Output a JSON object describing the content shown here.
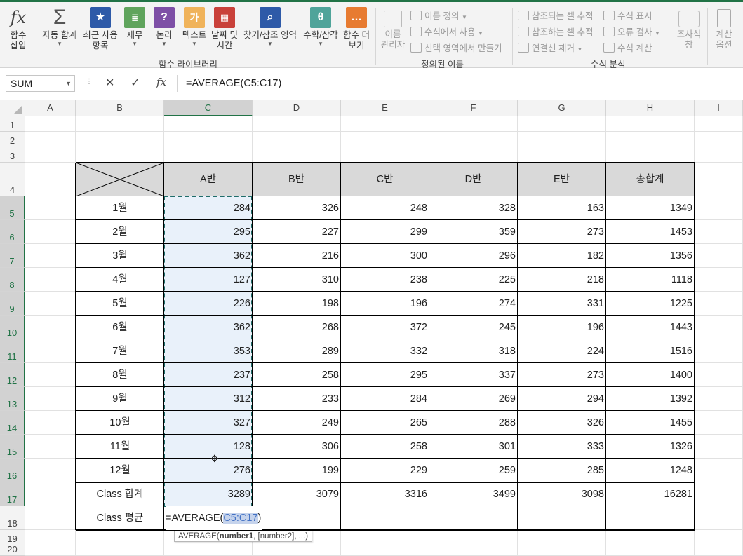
{
  "ribbon": {
    "insert_function": [
      "함수",
      "삽입"
    ],
    "autosum": "자동 합계",
    "recent": [
      "최근 사용",
      "항목"
    ],
    "financial": "재무",
    "logical": "논리",
    "text": "텍스트",
    "datetime": [
      "날짜 및",
      "시간"
    ],
    "lookup": "찾기/참조 영역",
    "math": "수학/삼각",
    "more": [
      "함수 더",
      "보기"
    ],
    "group_library": "함수 라이브러리",
    "name_manager": [
      "이름",
      "관리자"
    ],
    "define_name": "이름 정의",
    "use_in_formula": "수식에서 사용",
    "create_from_selection": "선택 영역에서 만들기",
    "group_defined_names": "정의된 이름",
    "trace_precedents": "참조되는 셀 추적",
    "trace_dependents": "참조하는 셀 추적",
    "remove_arrows": "연결선 제거",
    "show_formulas": "수식 표시",
    "error_checking": "오류 검사",
    "evaluate_formula": "수식 계산",
    "group_formula_auditing": "수식 분석",
    "watch_window": [
      "조사식",
      "창"
    ],
    "calc_options": [
      "계산",
      "옵션"
    ],
    "icon_glyphs": {
      "fx": "fx",
      "sigma": "Σ",
      "question": "?",
      "text": "가",
      "theta": "θ",
      "more": "…"
    }
  },
  "formula_bar": {
    "name_box": "SUM",
    "cancel": "✕",
    "enter": "✓",
    "fx": "fx",
    "formula": "=AVERAGE(C5:C17)"
  },
  "columns": [
    "A",
    "B",
    "C",
    "D",
    "E",
    "F",
    "G",
    "H",
    "I"
  ],
  "rows": [
    "1",
    "2",
    "3",
    "4",
    "5",
    "6",
    "7",
    "8",
    "9",
    "10",
    "11",
    "12",
    "13",
    "14",
    "15",
    "16",
    "17",
    "18",
    "19",
    "20"
  ],
  "table": {
    "headers": [
      "A반",
      "B반",
      "C반",
      "D반",
      "E반",
      "총합계"
    ],
    "body": [
      {
        "label": "1월",
        "values": [
          "284",
          "326",
          "248",
          "328",
          "163",
          "1349"
        ]
      },
      {
        "label": "2월",
        "values": [
          "295",
          "227",
          "299",
          "359",
          "273",
          "1453"
        ]
      },
      {
        "label": "3월",
        "values": [
          "362",
          "216",
          "300",
          "296",
          "182",
          "1356"
        ]
      },
      {
        "label": "4월",
        "values": [
          "127",
          "310",
          "238",
          "225",
          "218",
          "1118"
        ]
      },
      {
        "label": "5월",
        "values": [
          "226",
          "198",
          "196",
          "274",
          "331",
          "1225"
        ]
      },
      {
        "label": "6월",
        "values": [
          "362",
          "268",
          "372",
          "245",
          "196",
          "1443"
        ]
      },
      {
        "label": "7월",
        "values": [
          "353",
          "289",
          "332",
          "318",
          "224",
          "1516"
        ]
      },
      {
        "label": "8월",
        "values": [
          "237",
          "258",
          "295",
          "337",
          "273",
          "1400"
        ]
      },
      {
        "label": "9월",
        "values": [
          "312",
          "233",
          "284",
          "269",
          "294",
          "1392"
        ]
      },
      {
        "label": "10월",
        "values": [
          "327",
          "249",
          "265",
          "288",
          "326",
          "1455"
        ]
      },
      {
        "label": "11월",
        "values": [
          "128",
          "306",
          "258",
          "301",
          "333",
          "1326"
        ]
      },
      {
        "label": "12월",
        "values": [
          "276",
          "199",
          "229",
          "259",
          "285",
          "1248"
        ]
      }
    ],
    "total_label": "Class 합계",
    "total_values": [
      "3289",
      "3079",
      "3316",
      "3499",
      "3098",
      "16281"
    ],
    "avg_label": "Class 평균",
    "editing_prefix": "=AVERAGE(",
    "editing_ref": "C5:C17",
    "editing_suffix": ")"
  },
  "tooltip": {
    "fn": "AVERAGE(",
    "arg1": "number1",
    "rest": ", [number2], ...)"
  }
}
